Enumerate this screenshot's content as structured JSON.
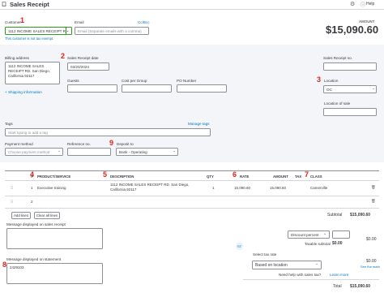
{
  "header": {
    "title": "Sales Receipt",
    "help_label": "Help"
  },
  "top": {
    "customer_label": "Customer",
    "customer_value": "1112 INCOME SALES RECEIPT RO",
    "customer_hint": "This customer is not tax exempt.",
    "email_label": "Email",
    "email_placeholder": "Email (Separate emails with a comma)",
    "cc_bcc": "Cc/Bcc",
    "amount_label": "AMOUNT",
    "amount": "$15,090.60"
  },
  "billing": {
    "billing_address_label": "Billing address",
    "billing_address": "1112 INCOME SALES RECEIPT RD. San Diego, California 92117",
    "date_label": "Sales Receipt date",
    "date_value": "03/20/2024",
    "receipt_no_label": "Sales Receipt no.",
    "receipt_no_value": "",
    "shipping_link": "Shipping information",
    "guests_label": "Guests",
    "cost_per_group_label": "Cost per Group",
    "po_number_label": "PO Number",
    "location_label": "Location",
    "location_value": "OC",
    "location_of_sale_label": "Location of sale"
  },
  "meta": {
    "tags_label": "Tags",
    "manage_tags": "Manage tags",
    "tags_placeholder": "Start typing to add a tag",
    "payment_method_label": "Payment method",
    "payment_method_placeholder": "Choose payment method",
    "reference_no_label": "Reference no.",
    "deposit_to_label": "Deposit to",
    "deposit_to_value": "Bank - Operating"
  },
  "table": {
    "columns": [
      "#",
      "PRODUCT/SERVICE",
      "DESCRIPTION",
      "QTY",
      "RATE",
      "AMOUNT",
      "TAX",
      "CLASS"
    ],
    "rows": [
      {
        "num": "1",
        "product": "Executive training",
        "description": "1112 INCOME SALES RECEIPT RD. San Diego, California 92117",
        "qty": "1",
        "rate": "15,090.60",
        "amount": "15,090.60",
        "tax": "",
        "class": "Camerville"
      },
      {
        "num": "2",
        "product": "",
        "description": "",
        "qty": "",
        "rate": "",
        "amount": "",
        "tax": "",
        "class": ""
      }
    ],
    "add_lines": "Add lines",
    "clear_all_lines": "Clear all lines"
  },
  "totals": {
    "subtotal_label": "Subtotal",
    "subtotal_value": "$15,090.60",
    "discount_label": "Discount percent",
    "discount_value": "$0.00",
    "taxable_subtotal_label": "Taxable subtotal",
    "taxable_subtotal_value": "$0.00",
    "select_tax_rate_label": "Select tax rate",
    "tax_value": "$0.00",
    "tax_select_value": "Based on location",
    "see_math": "See the math",
    "help_tax": "Need help with sales tax?",
    "learn_more": "Learn more",
    "total_label": "Total",
    "total_value": "$15,090.60"
  },
  "messages": {
    "receipt_message_label": "Message displayed on sales receipt",
    "statement_message_label": "Message displayed on statement",
    "statement_message_value": "2429103"
  },
  "annotations": [
    "1",
    "2",
    "3",
    "4",
    "5",
    "6",
    "7",
    "8",
    "9"
  ],
  "colors": {
    "annotation": "#e2231a",
    "link": "#0077c5",
    "accent_green": "#2ca01c"
  }
}
